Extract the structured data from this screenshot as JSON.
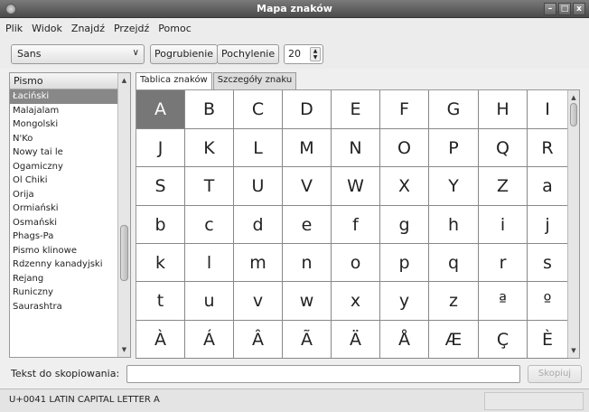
{
  "window": {
    "title": "Mapa znaków"
  },
  "menu": [
    "Plik",
    "Widok",
    "Znajdź",
    "Przejdź",
    "Pomoc"
  ],
  "toolbar": {
    "font": "Sans",
    "bold_label": "Pogrubienie",
    "italic_label": "Pochylenie",
    "size": "20"
  },
  "script_list": {
    "header": "Pismo",
    "items": [
      "Łaciński",
      "Malajalam",
      "Mongolski",
      "N'Ko",
      "Nowy tai le",
      "Ogamiczny",
      "Ol Chiki",
      "Orija",
      "Ormiański",
      "Osmański",
      "Phags-Pa",
      "Pismo klinowe",
      "Rdzenny kanadyjski",
      "Rejang",
      "Runiczny",
      "Saurashtra"
    ],
    "selected_index": 0
  },
  "tabs": [
    "Tablica znaków",
    "Szczegóły znaku"
  ],
  "char_grid": {
    "rows": [
      [
        "A",
        "B",
        "C",
        "D",
        "E",
        "F",
        "G",
        "H",
        "I"
      ],
      [
        "J",
        "K",
        "L",
        "M",
        "N",
        "O",
        "P",
        "Q",
        "R"
      ],
      [
        "S",
        "T",
        "U",
        "V",
        "W",
        "X",
        "Y",
        "Z",
        "a"
      ],
      [
        "b",
        "c",
        "d",
        "e",
        "f",
        "g",
        "h",
        "i",
        "j"
      ],
      [
        "k",
        "l",
        "m",
        "n",
        "o",
        "p",
        "q",
        "r",
        "s"
      ],
      [
        "t",
        "u",
        "v",
        "w",
        "x",
        "y",
        "z",
        "ª",
        "º"
      ],
      [
        "À",
        "Á",
        "Â",
        "Ã",
        "Ä",
        "Å",
        "Æ",
        "Ç",
        "È"
      ]
    ],
    "selected": "A"
  },
  "copy": {
    "label": "Tekst do skopiowania:",
    "value": "",
    "button": "Skopiuj"
  },
  "status": "U+0041 LATIN CAPITAL LETTER A"
}
